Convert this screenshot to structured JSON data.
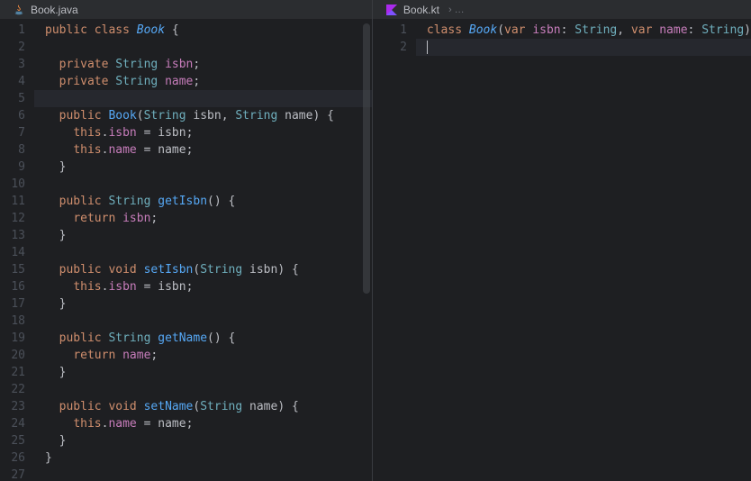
{
  "left": {
    "tab": {
      "filename": "Book.java"
    },
    "lines": [
      {
        "html": "<span class='kw'>public</span> <span class='kw'>class</span> <span class='cls'>Book</span> <span class='punct'>{</span>"
      },
      {
        "html": ""
      },
      {
        "html": "  <span class='kw'>private</span> <span class='str-type'>String</span> <span class='field'>isbn</span><span class='punct'>;</span>"
      },
      {
        "html": "  <span class='kw'>private</span> <span class='str-type'>String</span> <span class='field'>name</span><span class='punct'>;</span>"
      },
      {
        "html": "",
        "hl": true
      },
      {
        "html": "  <span class='kw'>public</span> <span class='mtd'>Book</span><span class='punct'>(</span><span class='str-type'>String</span> <span class='param'>isbn</span><span class='punct'>,</span> <span class='str-type'>String</span> <span class='param'>name</span><span class='punct'>) {</span>"
      },
      {
        "html": "    <span class='this'>this</span><span class='punct'>.</span><span class='field'>isbn</span> <span class='punct'>=</span> <span class='param'>isbn</span><span class='punct'>;</span>"
      },
      {
        "html": "    <span class='this'>this</span><span class='punct'>.</span><span class='field'>name</span> <span class='punct'>=</span> <span class='param'>name</span><span class='punct'>;</span>"
      },
      {
        "html": "  <span class='punct'>}</span>"
      },
      {
        "html": ""
      },
      {
        "html": "  <span class='kw'>public</span> <span class='str-type'>String</span> <span class='mtd'>getIsbn</span><span class='punct'>() {</span>"
      },
      {
        "html": "    <span class='ret'>return</span> <span class='field'>isbn</span><span class='punct'>;</span>"
      },
      {
        "html": "  <span class='punct'>}</span>"
      },
      {
        "html": ""
      },
      {
        "html": "  <span class='kw'>public</span> <span class='kw'>void</span> <span class='mtd'>setIsbn</span><span class='punct'>(</span><span class='str-type'>String</span> <span class='param'>isbn</span><span class='punct'>) {</span>"
      },
      {
        "html": "    <span class='this'>this</span><span class='punct'>.</span><span class='field'>isbn</span> <span class='punct'>=</span> <span class='param'>isbn</span><span class='punct'>;</span>"
      },
      {
        "html": "  <span class='punct'>}</span>"
      },
      {
        "html": ""
      },
      {
        "html": "  <span class='kw'>public</span> <span class='str-type'>String</span> <span class='mtd'>getName</span><span class='punct'>() {</span>"
      },
      {
        "html": "    <span class='ret'>return</span> <span class='field'>name</span><span class='punct'>;</span>"
      },
      {
        "html": "  <span class='punct'>}</span>"
      },
      {
        "html": ""
      },
      {
        "html": "  <span class='kw'>public</span> <span class='kw'>void</span> <span class='mtd'>setName</span><span class='punct'>(</span><span class='str-type'>String</span> <span class='param'>name</span><span class='punct'>) {</span>"
      },
      {
        "html": "    <span class='this'>this</span><span class='punct'>.</span><span class='field'>name</span> <span class='punct'>=</span> <span class='param'>name</span><span class='punct'>;</span>"
      },
      {
        "html": "  <span class='punct'>}</span>"
      },
      {
        "html": "<span class='punct'>}</span>"
      },
      {
        "html": ""
      }
    ]
  },
  "right": {
    "tab": {
      "filename": "Book.kt",
      "breadcrumb": "› …"
    },
    "lines": [
      {
        "html": "<span class='kw'>class</span> <span class='cls'>Book</span><span class='punct'>(</span><span class='kw'>var</span> <span class='field'>isbn</span><span class='punct'>:</span> <span class='str-type'>String</span><span class='punct'>,</span> <span class='kw'>var</span> <span class='field'>name</span><span class='punct'>:</span> <span class='str-type'>String</span><span class='punct'>)</span>"
      },
      {
        "html": "<span class='caret'></span>",
        "hl": true
      }
    ]
  }
}
